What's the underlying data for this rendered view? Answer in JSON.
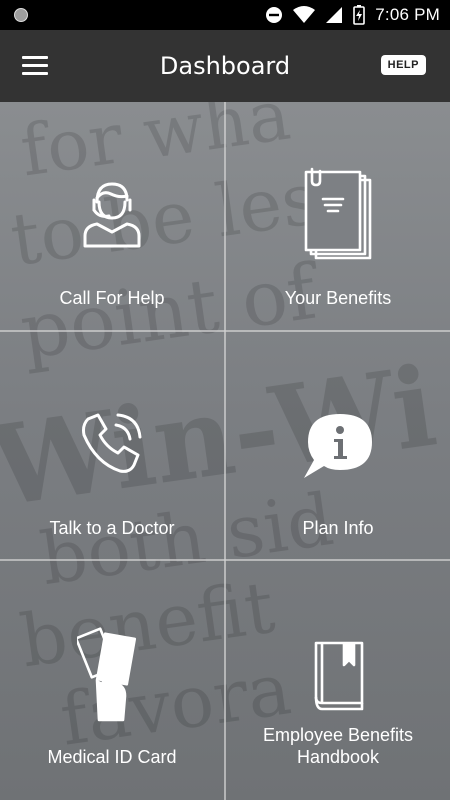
{
  "status_bar": {
    "time": "7:06 PM",
    "icons": [
      "circle-status-icon",
      "do-not-disturb-icon",
      "wifi-icon",
      "signal-icon",
      "battery-charging-icon"
    ]
  },
  "header": {
    "title": "Dashboard",
    "help_label": "HELP",
    "menu_icon": "hamburger-menu-icon"
  },
  "tiles": [
    {
      "label": "Call For Help",
      "icon": "support-agent-icon"
    },
    {
      "label": "Your Benefits",
      "icon": "documents-icon"
    },
    {
      "label": "Talk to a Doctor",
      "icon": "phone-call-icon"
    },
    {
      "label": "Plan Info",
      "icon": "info-speech-bubble-icon"
    },
    {
      "label": "Medical ID Card",
      "icon": "id-card-hand-icon"
    },
    {
      "label": "Employee Benefits Handbook",
      "icon": "book-icon"
    }
  ],
  "colors": {
    "app_bar": "#333333",
    "status_bar": "#000000",
    "text": "#ffffff"
  }
}
